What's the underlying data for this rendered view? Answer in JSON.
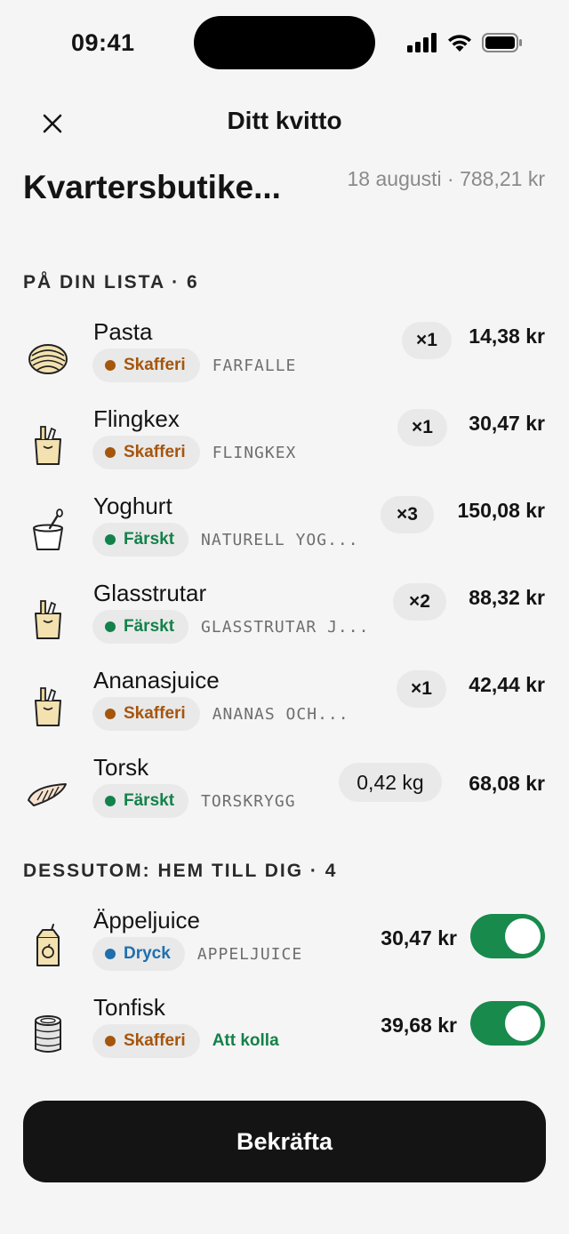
{
  "status_bar": {
    "time": "09:41"
  },
  "header": {
    "title": "Ditt kvitto"
  },
  "store": {
    "name": "Kvartersbutike...",
    "meta": "18 augusti · 788,21 kr"
  },
  "list_section": {
    "title": "PÅ DIN LISTA · 6",
    "items": [
      {
        "name": "Pasta",
        "icon": "pasta-icon",
        "category": "Skafferi",
        "sub": "FARFALLE",
        "qty": "×1",
        "price": "14,38 kr"
      },
      {
        "name": "Flingkex",
        "icon": "grocery-bag-icon",
        "category": "Skafferi",
        "sub": "FLINGKEX",
        "qty": "×1",
        "price": "30,47 kr"
      },
      {
        "name": "Yoghurt",
        "icon": "yoghurt-icon",
        "category": "Färskt",
        "sub": "NATURELL YOG...",
        "qty": "×3",
        "price": "150,08 kr"
      },
      {
        "name": "Glasstrutar",
        "icon": "grocery-bag-icon",
        "category": "Färskt",
        "sub": "GLASSTRUTAR J...",
        "qty": "×2",
        "price": "88,32 kr"
      },
      {
        "name": "Ananasjuice",
        "icon": "grocery-bag-icon",
        "category": "Skafferi",
        "sub": "ANANAS  OCH...",
        "qty": "×1",
        "price": "42,44 kr"
      },
      {
        "name": "Torsk",
        "icon": "fish-fillet-icon",
        "category": "Färskt",
        "sub": "TORSKRYGG",
        "qty": "0,42 kg",
        "price": "68,08 kr"
      }
    ]
  },
  "extra_section": {
    "title": "DESSUTOM: HEM TILL DIG · 4",
    "items": [
      {
        "name": "Äppeljuice",
        "icon": "juice-carton-icon",
        "category": "Dryck",
        "sub": "APPELJUICE",
        "price": "30,47 kr",
        "enabled": true
      },
      {
        "name": "Tonfisk",
        "icon": "tin-can-icon",
        "category": "Skafferi",
        "note": "Att kolla",
        "price": "39,68 kr",
        "enabled": true
      }
    ]
  },
  "confirm_label": "Bekräfta",
  "colors": {
    "skafferi": "#a5560d",
    "farskt": "#13814a",
    "dryck": "#1f6fae",
    "toggle_on": "#178a4c"
  }
}
